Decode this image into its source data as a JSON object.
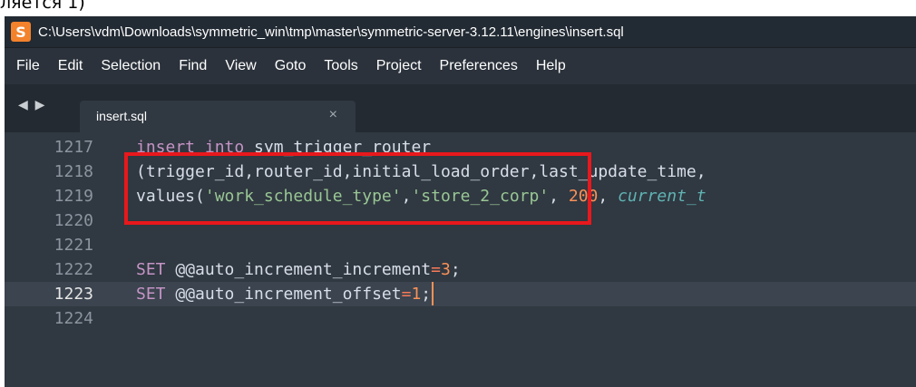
{
  "caption": {
    "text": "ляется 1)"
  },
  "window": {
    "title": "C:\\Users\\vdm\\Downloads\\symmetric_win\\tmp\\master\\symmetric-server-3.12.11\\engines\\insert.sql",
    "app_icon_glyph": "S",
    "app_icon_color": "#f2822c"
  },
  "menu": [
    "File",
    "Edit",
    "Selection",
    "Find",
    "View",
    "Goto",
    "Tools",
    "Project",
    "Preferences",
    "Help"
  ],
  "tabs": {
    "nav_arrows": "◀ ▶",
    "active": {
      "label": "insert.sql",
      "close": "×"
    }
  },
  "editor": {
    "lines": [
      {
        "number": "1217",
        "parts": [
          {
            "t": "kw",
            "v": "insert into"
          },
          {
            "t": "plain",
            "v": " sym_trigger_router"
          }
        ]
      },
      {
        "number": "1218",
        "parts": [
          {
            "t": "plain",
            "v": "(trigger_id,router_id,initial_load_order,last_update_time,"
          }
        ]
      },
      {
        "number": "1219",
        "parts": [
          {
            "t": "plain",
            "v": "values("
          },
          {
            "t": "str",
            "v": "'work_schedule_type'"
          },
          {
            "t": "plain",
            "v": ","
          },
          {
            "t": "str",
            "v": "'store_2_corp'"
          },
          {
            "t": "plain",
            "v": ", "
          },
          {
            "t": "num",
            "v": "200"
          },
          {
            "t": "plain",
            "v": ", "
          },
          {
            "t": "fn",
            "v": "current_t"
          }
        ]
      },
      {
        "number": "1220",
        "parts": []
      },
      {
        "number": "1221",
        "parts": []
      },
      {
        "number": "1222",
        "parts": [
          {
            "t": "kw",
            "v": "SET"
          },
          {
            "t": "plain",
            "v": " @@auto_increment_increment"
          },
          {
            "t": "op",
            "v": "="
          },
          {
            "t": "num",
            "v": "3"
          },
          {
            "t": "plain",
            "v": ";"
          }
        ]
      },
      {
        "number": "1223",
        "current": true,
        "cursor": true,
        "parts": [
          {
            "t": "kw",
            "v": "SET"
          },
          {
            "t": "plain",
            "v": " @@auto_increment_offset"
          },
          {
            "t": "op",
            "v": "="
          },
          {
            "t": "num",
            "v": "1"
          },
          {
            "t": "plain",
            "v": ";"
          }
        ]
      },
      {
        "number": "1224",
        "parts": []
      }
    ]
  },
  "colors": {
    "editor_bg": "#303841",
    "keyword": "#c594c5",
    "string": "#99c794",
    "number": "#f99157",
    "function": "#5fb3b3",
    "highlight_box": "#e8181c"
  }
}
